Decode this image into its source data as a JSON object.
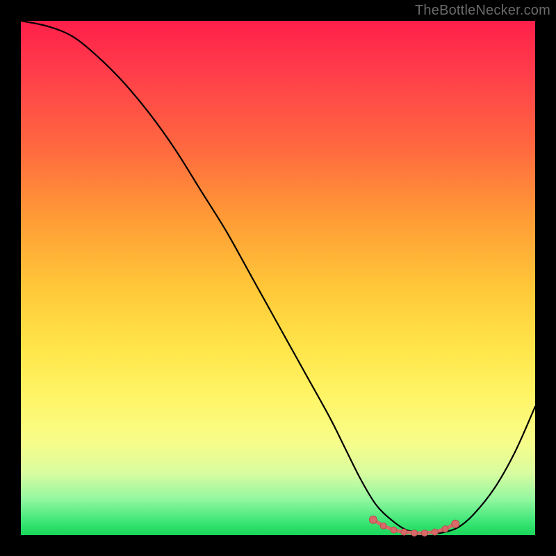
{
  "watermark": "TheBottleNecker.com",
  "colors": {
    "frame": "#000000",
    "curve": "#000000",
    "marker_fill": "#d86a6a",
    "marker_stroke": "#b94d4d"
  },
  "chart_data": {
    "type": "line",
    "title": "",
    "xlabel": "",
    "ylabel": "",
    "xlim": [
      0,
      100
    ],
    "ylim": [
      0,
      100
    ],
    "series": [
      {
        "name": "bottleneck-curve",
        "x": [
          0,
          5,
          10,
          15,
          20,
          25,
          30,
          35,
          40,
          45,
          50,
          55,
          60,
          63,
          66,
          69,
          72,
          75,
          78,
          80,
          82,
          85,
          88,
          92,
          96,
          100
        ],
        "y": [
          100,
          99,
          97,
          93,
          88,
          82,
          75,
          67,
          59,
          50,
          41,
          32,
          23,
          17,
          11,
          6,
          3,
          1,
          0.4,
          0.4,
          0.5,
          1.5,
          4,
          9,
          16,
          25
        ]
      }
    ],
    "markers": {
      "name": "trough-markers",
      "x": [
        68.5,
        70.5,
        72.5,
        74.5,
        76.5,
        78.5,
        80.5,
        82.5,
        84.5
      ],
      "y": [
        3.0,
        1.8,
        1.0,
        0.6,
        0.4,
        0.4,
        0.6,
        1.2,
        2.2
      ]
    },
    "gradient_stops": [
      {
        "pos": 0.0,
        "color": "#ff1f4a"
      },
      {
        "pos": 0.25,
        "color": "#ff6a3f"
      },
      {
        "pos": 0.52,
        "color": "#ffc838"
      },
      {
        "pos": 0.74,
        "color": "#fff66a"
      },
      {
        "pos": 0.93,
        "color": "#93f7a0"
      },
      {
        "pos": 1.0,
        "color": "#18d659"
      }
    ]
  }
}
